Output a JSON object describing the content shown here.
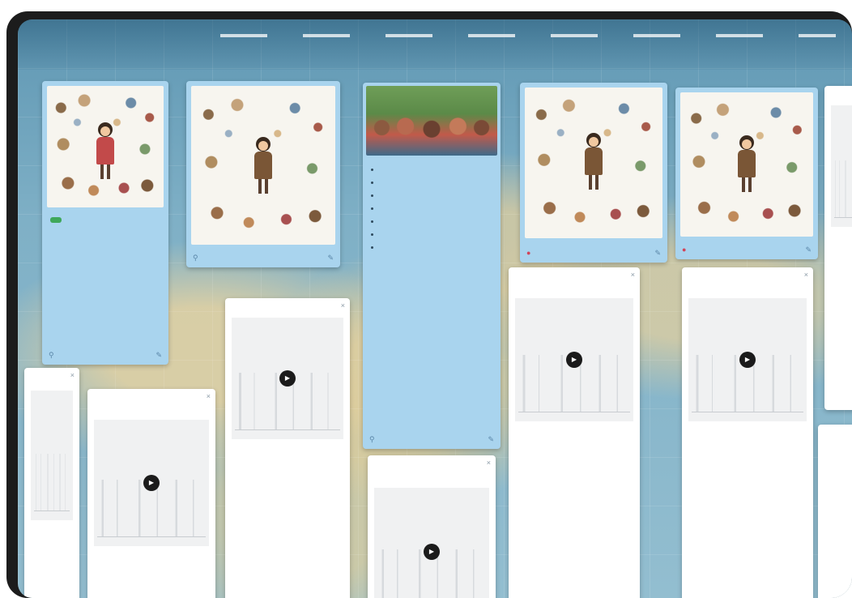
{
  "header": {
    "title": "",
    "subtitle": "",
    "meta": ""
  },
  "cards": {
    "card1": {
      "text": [
        "",
        "",
        ""
      ],
      "foot_left": "",
      "foot_right": ""
    },
    "card3": {
      "paragraphs": [
        "",
        "",
        ""
      ],
      "list_a": [
        "",
        ""
      ],
      "list_b": [
        "",
        "",
        "",
        "",
        ""
      ]
    },
    "widgets": {
      "w1": {
        "title": ""
      },
      "w2": {
        "title": ""
      },
      "w3": {
        "title": ""
      },
      "w4": {
        "title": ""
      },
      "w5": {
        "title": ""
      },
      "w6": {
        "title": ""
      }
    }
  },
  "colors": {
    "card_blue": "#a9d4ee",
    "map_water": "#7fb0c6",
    "like_red": "#d0455a",
    "tag_green": "#3fa85a"
  },
  "icons": {
    "play": "play-icon",
    "close": "close-icon",
    "like": "heart-icon",
    "comment": "comment-icon"
  }
}
